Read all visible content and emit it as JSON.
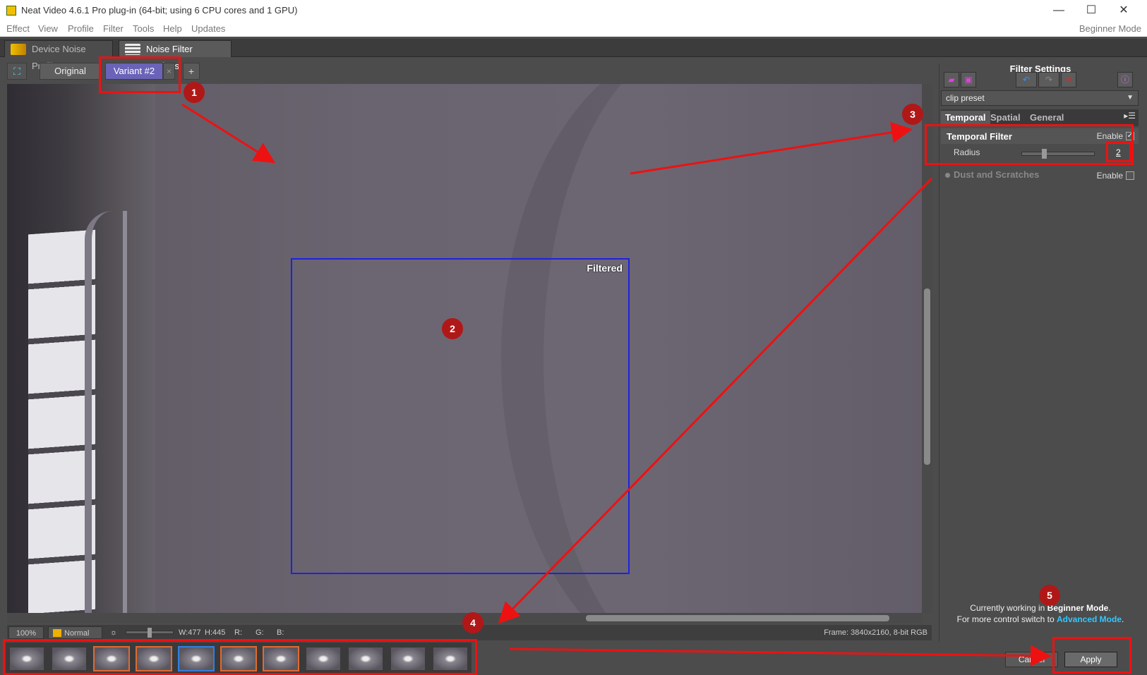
{
  "window": {
    "title": "Neat Video 4.6.1  Pro plug-in (64-bit; using 6 CPU cores and 1 GPU)",
    "minimize": "—",
    "maximize": "☐",
    "close": "✕"
  },
  "menu": {
    "items": [
      "Effect",
      "View",
      "Profile",
      "Filter",
      "Tools",
      "Help",
      "Updates"
    ],
    "mode": "Beginner Mode"
  },
  "main_tabs": {
    "device_noise_profile": "Device Noise Profile",
    "noise_filter_settings": "Noise Filter Settings"
  },
  "variants": {
    "original": "Original",
    "active": "Variant #2",
    "close": "×",
    "add": "+"
  },
  "viewer": {
    "filtered_label": "Filtered"
  },
  "status": {
    "zoom": "100%",
    "display_mode": "Normal",
    "width": "W:477",
    "height": "H:445",
    "r": "R:",
    "g": "G:",
    "b": "B:",
    "frame": "Frame: 3840x2160, 8-bit RGB"
  },
  "filmstrip": {
    "count": 11,
    "highlighted_orange": [
      3,
      4,
      6,
      7
    ],
    "highlighted_blue": [
      5
    ]
  },
  "panel": {
    "title": "Filter Settings",
    "preset": "clip preset",
    "tabs": [
      "Temporal",
      "Spatial",
      "General"
    ],
    "active_tab": "Temporal",
    "temporal_filter": {
      "label": "Temporal Filter",
      "enable_label": "Enable",
      "enabled": true,
      "radius_label": "Radius",
      "radius_value": "2"
    },
    "dust": {
      "label": "Dust and Scratches",
      "enable_label": "Enable",
      "enabled": false
    },
    "mode_message": {
      "line1_prefix": "Currently working in ",
      "line1_mode": "Beginner Mode",
      "line1_suffix": ".",
      "line2_prefix": "For more control switch to ",
      "line2_link": "Advanced Mode",
      "line2_suffix": "."
    }
  },
  "buttons": {
    "cancel": "Cancel",
    "apply": "Apply"
  },
  "annotations": [
    "1",
    "2",
    "3",
    "4",
    "5"
  ],
  "colors": {
    "annotation_red": "#ee1111",
    "variant_active": "#6a63b8",
    "filtered_box": "#2020e0",
    "advanced_link": "#30c8ff"
  }
}
